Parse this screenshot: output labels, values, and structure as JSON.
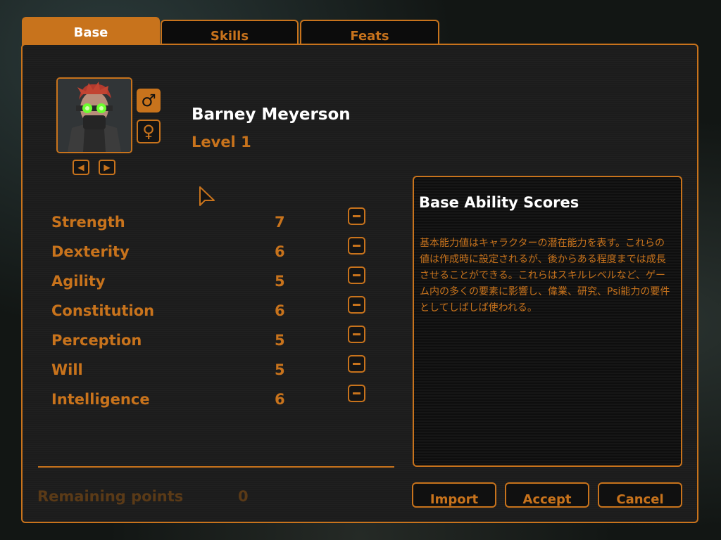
{
  "tabs": [
    {
      "label": "Base"
    },
    {
      "label": "Skills"
    },
    {
      "label": "Feats"
    }
  ],
  "character": {
    "name": "Barney Meyerson",
    "level": "Level 1",
    "male_symbol": "♂",
    "female_symbol": "♀",
    "prev_symbol": "◀",
    "next_symbol": "▶"
  },
  "attributes": [
    {
      "label": "Strength",
      "value": "7"
    },
    {
      "label": "Dexterity",
      "value": "6"
    },
    {
      "label": "Agility",
      "value": "5"
    },
    {
      "label": "Constitution",
      "value": "6"
    },
    {
      "label": "Perception",
      "value": "5"
    },
    {
      "label": "Will",
      "value": "5"
    },
    {
      "label": "Intelligence",
      "value": "6"
    }
  ],
  "remaining": {
    "label": "Remaining points",
    "value": "0"
  },
  "info": {
    "title": "Base Ability Scores",
    "text": "基本能力値はキャラクターの潜在能力を表す。これらの値は作成時に設定されるが、後からある程度までは成長させることができる。これらはスキルレベルなど、ゲーム内の多くの要素に影響し、偉業、研究、Psi能力の要件としてしばしば使われる。"
  },
  "buttons": {
    "import": "Import",
    "accept": "Accept",
    "cancel": "Cancel"
  },
  "colors": {
    "accent": "#c8731c",
    "panel": "#1c1c1c",
    "muted": "#5a3a17"
  }
}
